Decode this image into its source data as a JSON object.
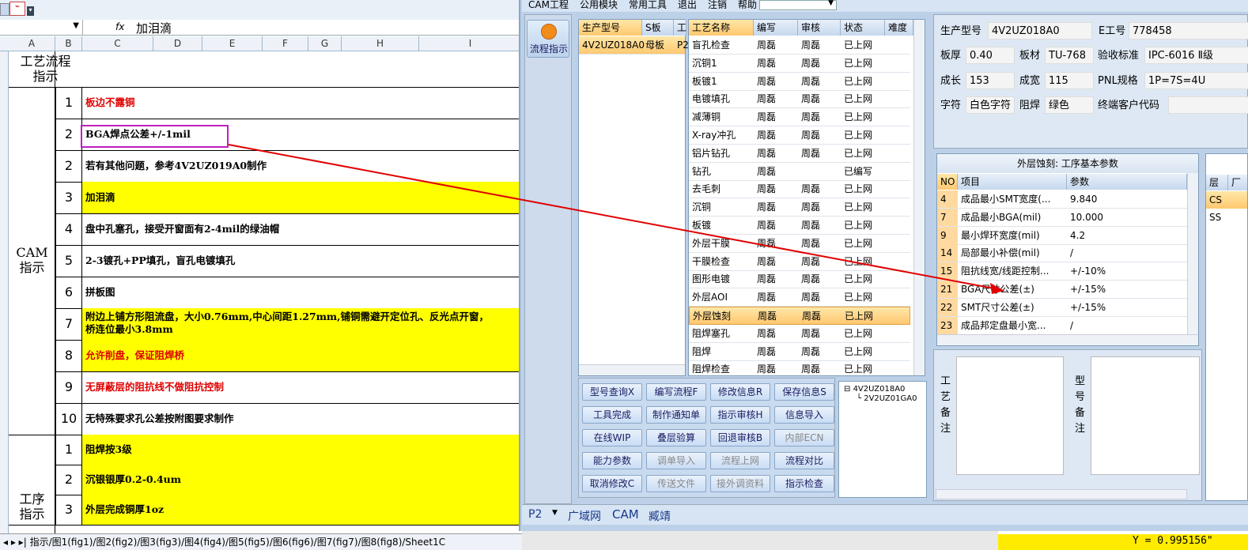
{
  "excel": {
    "formula_value": "加泪滴",
    "fx_label": "fx",
    "columns": [
      "A",
      "B",
      "C",
      "D",
      "E",
      "F",
      "G",
      "H",
      "I"
    ],
    "header_title": "工艺流程\n指示",
    "section_cam": "CAM\n指示",
    "section_proc": "工序\n指示",
    "rows": [
      {
        "num": "1",
        "text": "板边不露铜",
        "yellow": false,
        "red": true
      },
      {
        "num": "2",
        "text": "BGA焊点公差+/-1mil",
        "yellow": false,
        "red": false
      },
      {
        "num": "2",
        "text": "若有其他问题，参考4V2UZ019A0制作",
        "yellow": false,
        "red": false
      },
      {
        "num": "3",
        "text": "加泪滴",
        "yellow": true,
        "red": false
      },
      {
        "num": "4",
        "text": "盘中孔塞孔，接受开窗面有2-4mil的绿油帽",
        "yellow": false,
        "red": false
      },
      {
        "num": "5",
        "text": "2-3镀孔+PP填孔，盲孔电镀填孔",
        "yellow": false,
        "red": false
      },
      {
        "num": "6",
        "text": "拼板图",
        "yellow": false,
        "red": false
      },
      {
        "num": "7",
        "text": "附边上铺方形阻流盘，大小0.76mm,中心间距1.27mm,铺铜需避开定位孔、反光点开窗，",
        "text2": "桥连位最小3.8mm",
        "yellow": true,
        "red": false
      },
      {
        "num": "8",
        "text": "允许削盘，保证阻焊桥",
        "yellow": true,
        "red": true
      },
      {
        "num": "9",
        "text": "无屏蔽层的阻抗线不做阻抗控制",
        "yellow": false,
        "red": true
      },
      {
        "num": "10",
        "text": "无特殊要求孔公差按附图要求制作",
        "yellow": false,
        "red": false
      },
      {
        "num": "1",
        "text": "阻焊按3级",
        "yellow": true,
        "red": false
      },
      {
        "num": "2",
        "text": "沉银银厚0.2-0.4um",
        "yellow": true,
        "red": false
      },
      {
        "num": "3",
        "text": "外层完成铜厚1oz",
        "yellow": true,
        "red": false
      }
    ],
    "sheet_tabs": "指示/图1(fig1)/图2(fig2)/图3(fig3)/图4(fig4)/图5(fig5)/图6(fig6)/图7(fig7)/图8(fig8)/Sheet1C"
  },
  "cam": {
    "menu": [
      "CAM工程",
      "公用模块",
      "常用工具",
      "退出",
      "注销",
      "帮助"
    ],
    "flow_button": "流程指示",
    "model_list": {
      "headers": [
        "生产型号",
        "S板",
        "工"
      ],
      "row": [
        "4V2UZ018A0",
        "母板",
        "P2"
      ]
    },
    "process": {
      "headers": [
        "工艺名称",
        "编写",
        "审核",
        "状态",
        "难度"
      ],
      "rows": [
        [
          "盲孔检查",
          "周磊",
          "周磊",
          "已上网"
        ],
        [
          "沉铜1",
          "周磊",
          "周磊",
          "已上网"
        ],
        [
          "板镀1",
          "周磊",
          "周磊",
          "已上网"
        ],
        [
          "电镀填孔",
          "周磊",
          "周磊",
          "已上网"
        ],
        [
          "减薄铜",
          "周磊",
          "周磊",
          "已上网"
        ],
        [
          "X-ray冲孔",
          "周磊",
          "周磊",
          "已上网"
        ],
        [
          "铝片钻孔",
          "周磊",
          "周磊",
          "已上网"
        ],
        [
          "钻孔",
          "周磊",
          "",
          "已编写"
        ],
        [
          "去毛刺",
          "周磊",
          "周磊",
          "已上网"
        ],
        [
          "沉铜",
          "周磊",
          "周磊",
          "已上网"
        ],
        [
          "板镀",
          "周磊",
          "周磊",
          "已上网"
        ],
        [
          "外层干膜",
          "周磊",
          "周磊",
          "已上网"
        ],
        [
          "干膜检查",
          "周磊",
          "周磊",
          "已上网"
        ],
        [
          "图形电镀",
          "周磊",
          "周磊",
          "已上网"
        ],
        [
          "外层AOI",
          "周磊",
          "周磊",
          "已上网"
        ],
        [
          "外层蚀刻",
          "周磊",
          "周磊",
          "已上网"
        ],
        [
          "阻焊塞孔",
          "周磊",
          "周磊",
          "已上网"
        ],
        [
          "阻焊",
          "周磊",
          "周磊",
          "已上网"
        ],
        [
          "阻焊检查",
          "周磊",
          "周磊",
          "已上网"
        ]
      ],
      "selected_index": 15
    },
    "buttons": [
      [
        "型号查询X",
        "编写流程F",
        "修改信息R",
        "保存信息S"
      ],
      [
        "工具完成",
        "制作通知单",
        "指示审核H",
        "信息导入"
      ],
      [
        "在线WIP",
        "叠层验算",
        "回退审核B",
        "内部ECN"
      ],
      [
        "能力参数",
        "调单导入",
        "流程上网",
        "流程对比"
      ],
      [
        "取消修改C",
        "传送文件",
        "接外调资料",
        "指示检查"
      ]
    ],
    "disabled_buttons": [
      "内部ECN",
      "调单导入",
      "流程上网",
      "传送文件",
      "接外调资料"
    ],
    "tree": [
      "4V2UZ018A0",
      "2V2UZ01GA0"
    ],
    "info": {
      "model_label": "生产型号",
      "model": "4V2UZ018A0",
      "e_label": "E工号",
      "e_no": "778458",
      "thick_label": "板厚",
      "thick": "0.40",
      "material_label": "板材",
      "material": "TU-768",
      "std_label": "验收标准",
      "std": "IPC-6016 Ⅱ级",
      "len_label": "成长",
      "len": "153",
      "wid_label": "成宽",
      "wid": "115",
      "pnl_label": "PNL规格",
      "pnl": "1P=7S=4U",
      "char_label": "字符",
      "char": "白色字符",
      "mask_label": "阻焊",
      "mask": "绿色",
      "cust_label": "终端客户代码",
      "cust": ""
    },
    "params": {
      "title": "外层蚀刻: 工序基本参数",
      "headers": [
        "NO",
        "项目",
        "参数"
      ],
      "rows": [
        [
          "4",
          "成品最小SMT宽度(...",
          "9.840"
        ],
        [
          "7",
          "成品最小BGA(mil)",
          "10.000"
        ],
        [
          "9",
          "最小焊环宽度(mil)",
          "4.2"
        ],
        [
          "14",
          "局部最小补偿(mil)",
          "/"
        ],
        [
          "15",
          "阻抗线宽/线距控制...",
          "+/-10%"
        ],
        [
          "21",
          "BGA尺寸公差(±)",
          "+/-15%"
        ],
        [
          "22",
          "SMT尺寸公差(±)",
          "+/-15%"
        ],
        [
          "23",
          "成品邦定盘最小宽...",
          "/"
        ]
      ]
    },
    "layer": {
      "headers": [
        "层",
        "厂"
      ],
      "rows": [
        "CS",
        "SS"
      ]
    },
    "notes": {
      "proc": "工艺备注",
      "model": "型号备注"
    },
    "status": [
      "P2",
      "广域网",
      "CAM",
      "臧靖"
    ]
  },
  "y_readout": "Y = 0.995156\""
}
